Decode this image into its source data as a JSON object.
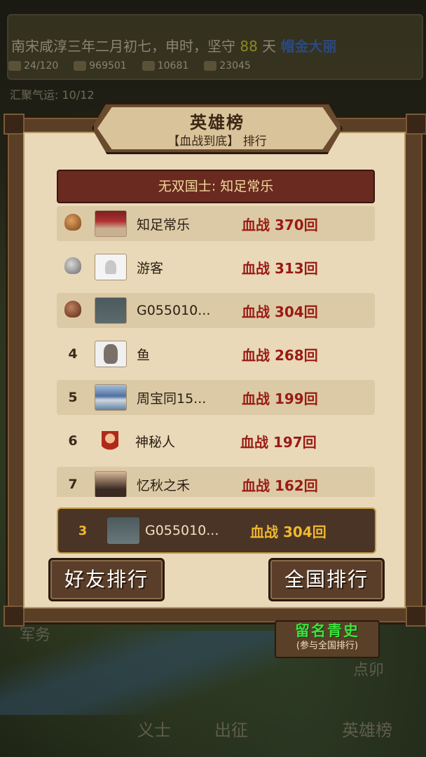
{
  "hud": {
    "date_prefix": "南宋咸淳三年二月初七，申时，坚守",
    "days": "88",
    "days_suffix": "天",
    "highlight": "帽金大丽",
    "stats": [
      "24/120",
      "969501",
      "10681",
      "23045"
    ],
    "luck": "汇聚气运: 10/12"
  },
  "background_labels": {
    "military": "军务",
    "mao": "点卯",
    "bottom": [
      "义士",
      "出征",
      "英雄榜"
    ]
  },
  "panel": {
    "title": "英雄榜",
    "subtitle": "【血战到底】 排行",
    "champion": "无双国士: 知足常乐"
  },
  "rows": [
    {
      "rank": "",
      "medal": "gold",
      "name": "知足常乐",
      "score": "血战 370回"
    },
    {
      "rank": "",
      "medal": "silver",
      "name": "游客",
      "score": "血战 313回"
    },
    {
      "rank": "",
      "medal": "bronze",
      "name": "G055010...",
      "score": "血战 304回"
    },
    {
      "rank": "4",
      "medal": "",
      "name": "鱼",
      "score": "血战 268回"
    },
    {
      "rank": "5",
      "medal": "",
      "name": "周宝同15...",
      "score": "血战 199回"
    },
    {
      "rank": "6",
      "medal": "",
      "name": "神秘人",
      "score": "血战 197回"
    },
    {
      "rank": "7",
      "medal": "",
      "name": "忆秋之禾",
      "score": "血战 162回"
    }
  ],
  "self": {
    "rank": "3",
    "name": "G055010...",
    "score": "血战 304回"
  },
  "buttons": {
    "friends": "好友排行",
    "national": "全国排行"
  },
  "fame": {
    "main": "留名青史",
    "sub": "(参与全国排行)"
  },
  "colors": {
    "panel_bg": "#e9d9b8",
    "score": "#9a1a14",
    "self_border": "#c8a040",
    "fame_text": "#40e040"
  }
}
